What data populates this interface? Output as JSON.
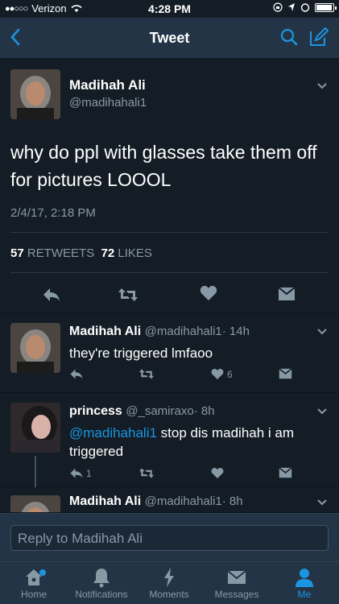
{
  "status_bar": {
    "carrier": "Verizon",
    "time": "4:28 PM"
  },
  "nav": {
    "title": "Tweet"
  },
  "main_tweet": {
    "name": "Madihah Ali",
    "handle": "@madihahali1",
    "text": "why do ppl with glasses take them off for pictures LOOOL",
    "date": "2/4/17, 2:18 PM",
    "retweets_count": "57",
    "retweets_label": "RETWEETS",
    "likes_count": "72",
    "likes_label": "LIKES"
  },
  "replies": [
    {
      "name": "Madihah Ali",
      "handle": "@madihahali1",
      "time": "· 14h",
      "text": "they're triggered lmfaoo",
      "likes": "6"
    },
    {
      "name": "princess",
      "handle": "@_samiraxo",
      "time": "· 8h",
      "mention": "@madihahali1",
      "text": " stop dis madihah i am triggered",
      "replies": "1"
    },
    {
      "name": "Madihah Ali",
      "handle": "@madihahali1",
      "time": "· 8h"
    }
  ],
  "composer": {
    "placeholder": "Reply to Madihah Ali"
  },
  "tabs": [
    {
      "label": "Home",
      "icon": "home-icon"
    },
    {
      "label": "Notifications",
      "icon": "bell-icon"
    },
    {
      "label": "Moments",
      "icon": "lightning-icon"
    },
    {
      "label": "Messages",
      "icon": "envelope-icon"
    },
    {
      "label": "Me",
      "icon": "person-icon"
    }
  ],
  "colors": {
    "background": "#141d26",
    "bar": "#243447",
    "accent": "#1b95e0",
    "muted": "#8899a6"
  }
}
